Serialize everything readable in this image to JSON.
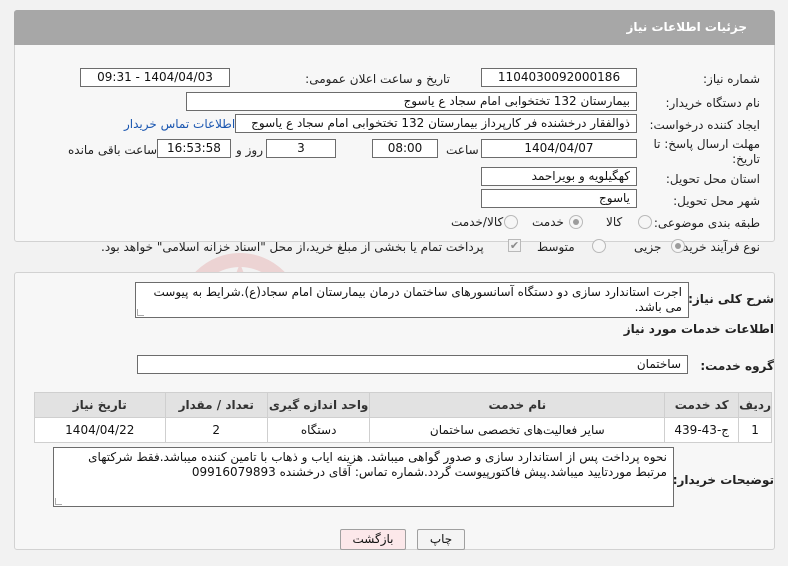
{
  "header": {
    "title": "جزئیات اطلاعات نیاز"
  },
  "form": {
    "need_number": {
      "label": "شماره نیاز:",
      "value": "1104030092000186"
    },
    "announce_datetime": {
      "label": "تاریخ و ساعت اعلان عمومی:",
      "value": "1404/04/03 - 09:31"
    },
    "buyer_org": {
      "label": "نام دستگاه خریدار:",
      "value": "بیمارستان 132 تختخوابی امام سجاد  ع  یاسوج"
    },
    "requester": {
      "label": "ایجاد کننده درخواست:",
      "value": "ذوالفقار درخشنده فر کارپرداز بیمارستان 132 تختخوابی امام سجاد  ع  یاسوج",
      "contact_link": "اطلاعات تماس خریدار"
    },
    "deadline": {
      "label_line1": "مهلت ارسال پاسخ: تا",
      "label_line2": "تاریخ:",
      "date": "1404/04/07",
      "time_label": "ساعت",
      "time": "08:00",
      "days": "3",
      "days_label": "روز و",
      "remaining": "16:53:58",
      "remaining_label": "ساعت باقی مانده"
    },
    "province": {
      "label": "استان محل تحویل:",
      "value": "کهگیلویه و بویراحمد"
    },
    "city": {
      "label": "شهر محل تحویل:",
      "value": "یاسوج"
    },
    "category": {
      "label": "طبقه بندی موضوعی:",
      "options": [
        "کالا",
        "خدمت",
        "کالا/خدمت"
      ],
      "selected": "خدمت"
    },
    "purchase_type": {
      "label": "نوع فرآیند خرید :",
      "options": [
        "جزیی",
        "متوسط"
      ],
      "note": "پرداخت تمام یا بخشی از مبلغ خرید،از محل \"اسناد خزانه اسلامی\" خواهد بود."
    }
  },
  "description": {
    "label": "شرح کلی نیاز:",
    "text": "اجرت استاندارد سازی دو دستگاه  آسانسورهای ساختمان درمان بیمارستان امام سجاد(ع).شرایط به پیوست می باشد."
  },
  "services": {
    "section_title": "اطلاعات خدمات مورد نیاز",
    "group_label": "گروه خدمت:",
    "group_value": "ساختمان",
    "columns": [
      "ردیف",
      "کد خدمت",
      "نام خدمت",
      "واحد اندازه گیری",
      "تعداد / مقدار",
      "تاریخ نیاز"
    ],
    "rows": [
      [
        "1",
        "ج-43-439",
        "سایر فعالیت‌های تخصصی ساختمان",
        "دستگاه",
        "2",
        "1404/04/22"
      ]
    ]
  },
  "buyer_notes": {
    "label": "توضیحات خریدار:",
    "text": "نحوه پرداخت پس از استاندارد سازی و صدور گواهی میباشد. هزینه ایاب و ذهاب با تامین کننده میباشد.فقط شرکتهای مرتبط موردتایید میباشد.پیش فاکتورپیوست گردد.شماره تماس: آقای درخشنده 09916079893"
  },
  "buttons": {
    "print": "چاپ",
    "back": "بازگشت"
  },
  "watermark": {
    "text": "AriaTender.net"
  },
  "colors": {
    "header_bg": "#a7a7a7",
    "link": "#1a56b0",
    "back_button_bg": "#fce8ea",
    "watermark": "#e8c9c9"
  },
  "icons": {
    "resize": "resize-grip-icon",
    "checkbox": "checkmark-icon"
  }
}
